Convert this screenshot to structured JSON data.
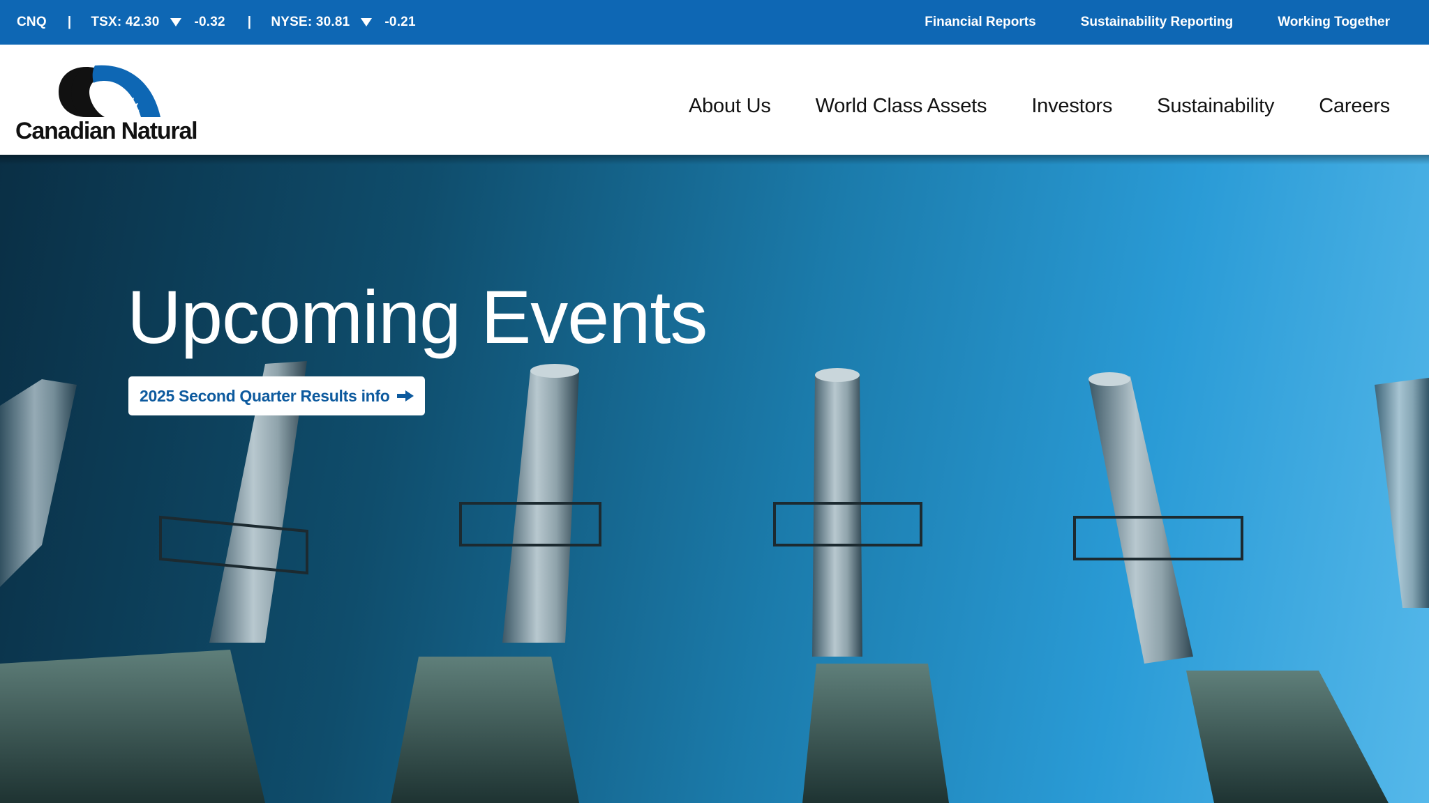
{
  "ticker": {
    "symbol": "CNQ",
    "separator": "|",
    "tsx_quote": "TSX: 42.30",
    "tsx_change": "-0.32",
    "nyse_quote": "NYSE: 30.81",
    "nyse_change": "-0.21",
    "trend_icon": "down-triangle-icon"
  },
  "utility_nav": {
    "items": [
      "Financial Reports",
      "Sustainability Reporting",
      "Working Together"
    ]
  },
  "brand": {
    "name": "Canadian Natural",
    "colors": {
      "primary": "#0e67b4",
      "dark": "#111111"
    }
  },
  "main_nav": {
    "items": [
      "About Us",
      "World Class Assets",
      "Investors",
      "Sustainability",
      "Careers"
    ]
  },
  "hero": {
    "title": "Upcoming Events",
    "cta_label": "2025 Second Quarter Results info",
    "cta_icon": "arrow-right-icon"
  }
}
